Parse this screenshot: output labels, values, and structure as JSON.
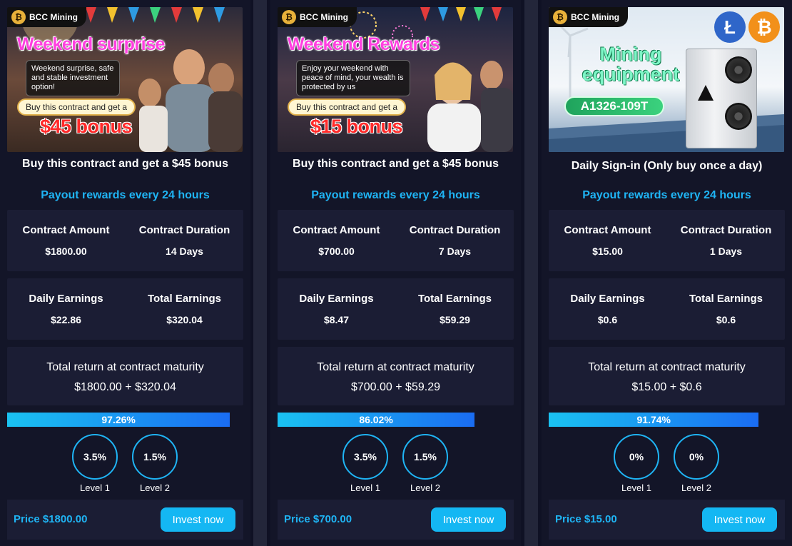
{
  "brand": "BCC Mining",
  "colors": {
    "accent": "#1fb4f4",
    "background": "#0f1124",
    "panel": "#1b1d34"
  },
  "cards": [
    {
      "banner": {
        "headline": "Weekend surprise",
        "promo_text": "Weekend surprise, safe and stable investment option!",
        "promo_pill": "Buy this contract and get a",
        "bonus": "$45 bonus"
      },
      "title": "Buy this contract and get a $45 bonus",
      "payout": "Payout rewards every 24 hours",
      "contract_amount_label": "Contract Amount",
      "contract_amount": "$1800.00",
      "contract_duration_label": "Contract Duration",
      "contract_duration": "14 Days",
      "daily_earnings_label": "Daily Earnings",
      "daily_earnings": "$22.86",
      "total_earnings_label": "Total Earnings",
      "total_earnings": "$320.04",
      "return_label": "Total return at contract maturity",
      "return_value": "$1800.00 + $320.04",
      "progress": 97.26,
      "progress_label": "97.26%",
      "level1": "3.5%",
      "level1_label": "Level 1",
      "level2": "1.5%",
      "level2_label": "Level 2",
      "price": "Price $1800.00",
      "invest_label": "Invest now"
    },
    {
      "banner": {
        "headline": "Weekend Rewards",
        "promo_text": "Enjoy your weekend with peace of mind, your wealth is protected by us",
        "promo_pill": "Buy this contract and get a",
        "bonus": "$15 bonus"
      },
      "title": "Buy this contract and get a $45 bonus",
      "payout": "Payout rewards every 24 hours",
      "contract_amount_label": "Contract Amount",
      "contract_amount": "$700.00",
      "contract_duration_label": "Contract Duration",
      "contract_duration": "7 Days",
      "daily_earnings_label": "Daily Earnings",
      "daily_earnings": "$8.47",
      "total_earnings_label": "Total Earnings",
      "total_earnings": "$59.29",
      "return_label": "Total return at contract maturity",
      "return_value": "$700.00 + $59.29",
      "progress": 86.02,
      "progress_label": "86.02%",
      "level1": "3.5%",
      "level1_label": "Level 1",
      "level2": "1.5%",
      "level2_label": "Level 2",
      "price": "Price $700.00",
      "invest_label": "Invest now"
    },
    {
      "banner": {
        "headline": "Mining equipment",
        "model": "A1326-109T",
        "litecoin_icon": "litecoin-icon",
        "bitcoin_icon": "bitcoin-icon"
      },
      "title": "Daily Sign-in  (Only buy once a day)",
      "payout": "Payout rewards every 24 hours",
      "contract_amount_label": "Contract Amount",
      "contract_amount": "$15.00",
      "contract_duration_label": "Contract Duration",
      "contract_duration": "1 Days",
      "daily_earnings_label": "Daily Earnings",
      "daily_earnings": "$0.6",
      "total_earnings_label": "Total Earnings",
      "total_earnings": "$0.6",
      "return_label": "Total return at contract maturity",
      "return_value": "$15.00 + $0.6",
      "progress": 91.74,
      "progress_label": "91.74%",
      "level1": "0%",
      "level1_label": "Level 1",
      "level2": "0%",
      "level2_label": "Level 2",
      "price": "Price $15.00",
      "invest_label": "Invest now"
    }
  ]
}
